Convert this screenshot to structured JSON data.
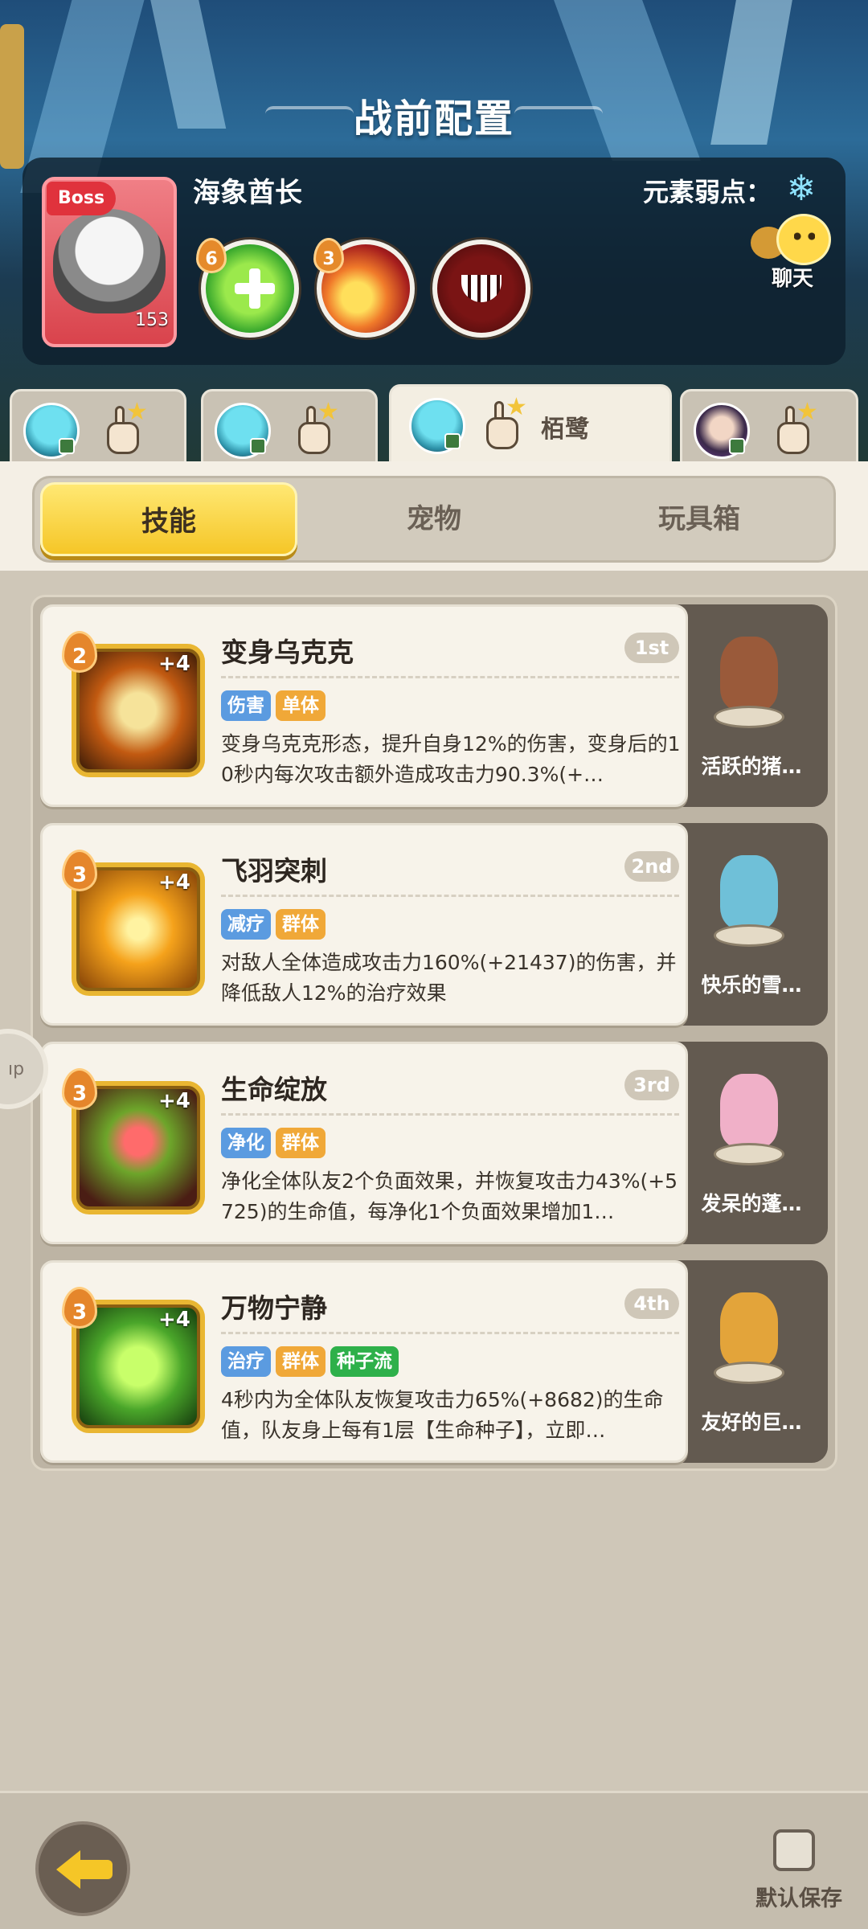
{
  "header": {
    "title": "战前配置"
  },
  "boss": {
    "tag": "Boss",
    "level": "153",
    "name": "海象酋长",
    "weakness_label": "元素弱点：",
    "weakness_icon": "snowflake-icon",
    "skills": [
      {
        "icon": "heal-cross-icon",
        "cost": "6"
      },
      {
        "icon": "fire-slash-icon",
        "cost": "3"
      },
      {
        "icon": "monster-mouth-icon",
        "cost": ""
      }
    ]
  },
  "chat": {
    "label": "聊天"
  },
  "team_tabs": [
    {
      "name": "",
      "active": false
    },
    {
      "name": "",
      "active": false
    },
    {
      "name": "栢鹭",
      "active": true
    },
    {
      "name": "",
      "active": false
    }
  ],
  "segments": [
    {
      "label": "技能",
      "active": true
    },
    {
      "label": "宠物",
      "active": false
    },
    {
      "label": "玩具箱",
      "active": false
    }
  ],
  "skills": [
    {
      "title": "变身乌克克",
      "order": "1st",
      "cost": "2",
      "plus": "+4",
      "tags": [
        {
          "text": "伤害",
          "color": "blue"
        },
        {
          "text": "单体",
          "color": "orange"
        }
      ],
      "desc": "变身乌克克形态，提升自身12%的伤害，变身后的10秒内每次攻击额外造成攻击力90.3%(+…",
      "pet": "活跃的猪…"
    },
    {
      "title": "飞羽突刺",
      "order": "2nd",
      "cost": "3",
      "plus": "+4",
      "tags": [
        {
          "text": "减疗",
          "color": "blue"
        },
        {
          "text": "群体",
          "color": "orange"
        }
      ],
      "desc": "对敌人全体造成攻击力160%(+21437)的伤害，并降低敌人12%的治疗效果",
      "pet": "快乐的雪…"
    },
    {
      "title": "生命绽放",
      "order": "3rd",
      "cost": "3",
      "plus": "+4",
      "tags": [
        {
          "text": "净化",
          "color": "blue"
        },
        {
          "text": "群体",
          "color": "orange"
        }
      ],
      "desc": "净化全体队友2个负面效果，并恢复攻击力43%(+5725)的生命值，每净化1个负面效果增加1…",
      "pet": "发呆的蓬…"
    },
    {
      "title": "万物宁静",
      "order": "4th",
      "cost": "3",
      "plus": "+4",
      "tags": [
        {
          "text": "治疗",
          "color": "blue"
        },
        {
          "text": "群体",
          "color": "orange"
        },
        {
          "text": "种子流",
          "color": "green"
        }
      ],
      "desc": "4秒内为全体队友恢复攻击力65%(+8682)的生命值，队友身上每有1层【生命种子】，立即…",
      "pet": "友好的巨…"
    }
  ],
  "footer": {
    "save_label": "默认保存",
    "side_label": "ıp"
  }
}
